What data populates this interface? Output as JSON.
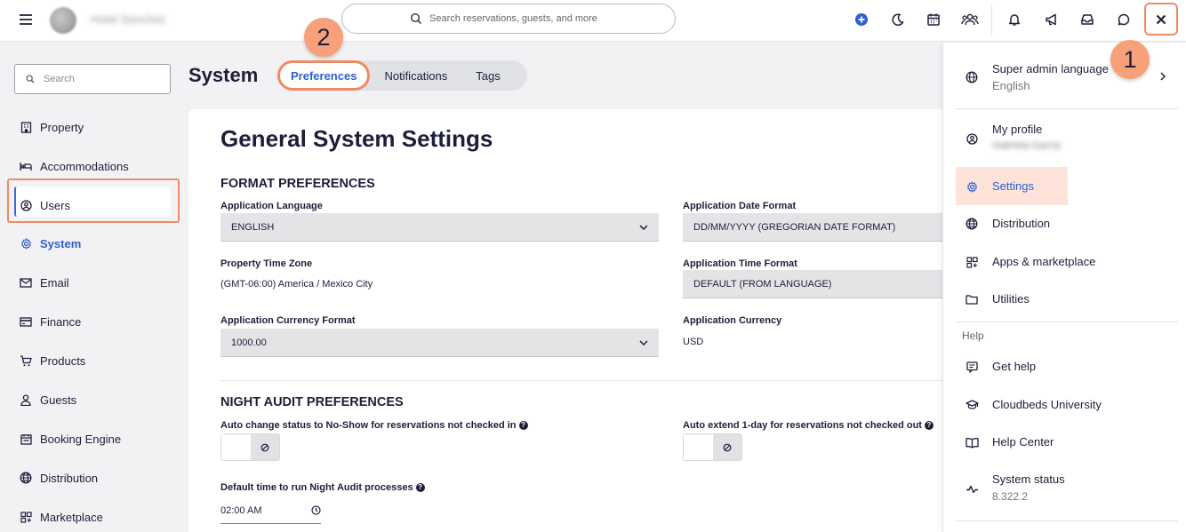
{
  "topbar": {
    "hotel_name": "Hotel Sanchez",
    "search_placeholder": "Search reservations, guests, and more"
  },
  "sidebar": {
    "search_placeholder": "Search",
    "items": [
      {
        "label": "Property",
        "icon": "building-icon"
      },
      {
        "label": "Accommodations",
        "icon": "bed-icon"
      },
      {
        "label": "Users",
        "icon": "user-circle-icon"
      },
      {
        "label": "System",
        "icon": "gear-icon"
      },
      {
        "label": "Email",
        "icon": "mail-icon"
      },
      {
        "label": "Finance",
        "icon": "card-icon"
      },
      {
        "label": "Products",
        "icon": "cart-icon"
      },
      {
        "label": "Guests",
        "icon": "person-icon"
      },
      {
        "label": "Booking Engine",
        "icon": "calendar-book-icon"
      },
      {
        "label": "Distribution",
        "icon": "globe-icon"
      },
      {
        "label": "Marketplace",
        "icon": "grid-icon"
      }
    ]
  },
  "page": {
    "title": "System",
    "tabs": [
      "Preferences",
      "Notifications",
      "Tags"
    ],
    "badge_1": "1",
    "badge_2": "2"
  },
  "settings": {
    "heading": "General System Settings",
    "format_heading": "FORMAT PREFERENCES",
    "app_language_label": "Application Language",
    "app_language_value": "ENGLISH",
    "date_format_label": "Application Date Format",
    "date_format_value": "DD/MM/YYYY (GREGORIAN DATE FORMAT)",
    "timezone_label": "Property Time Zone",
    "timezone_value": "(GMT-06:00) America / Mexico City",
    "time_format_label": "Application Time Format",
    "time_format_value": "DEFAULT (FROM LANGUAGE)",
    "currency_format_label": "Application Currency Format",
    "currency_format_value": "1000.00",
    "currency_label": "Application Currency",
    "currency_value": "USD",
    "night_heading": "NIGHT AUDIT PREFERENCES",
    "noshow_label": "Auto change status to No-Show for reservations not checked in",
    "extend_label": "Auto extend 1-day for reservations not checked out",
    "night_time_label": "Default time to run Night Audit processes",
    "night_time_value": "02:00 AM"
  },
  "panel": {
    "language_label": "Super admin language",
    "language_value": "English",
    "profile_label": "My profile",
    "profile_name": "Gabriela Garcia",
    "settings": "Settings",
    "distribution": "Distribution",
    "apps": "Apps & marketplace",
    "utilities": "Utilities",
    "help_heading": "Help",
    "get_help": "Get help",
    "university": "Cloudbeds University",
    "help_center": "Help Center",
    "system_status": "System status",
    "version": "8.322.2"
  },
  "colors": {
    "accent_blue": "#2f5fd0",
    "highlight_orange": "#f08a62",
    "badge_fill": "#f7a07a",
    "settings_highlight": "#fde3da"
  }
}
